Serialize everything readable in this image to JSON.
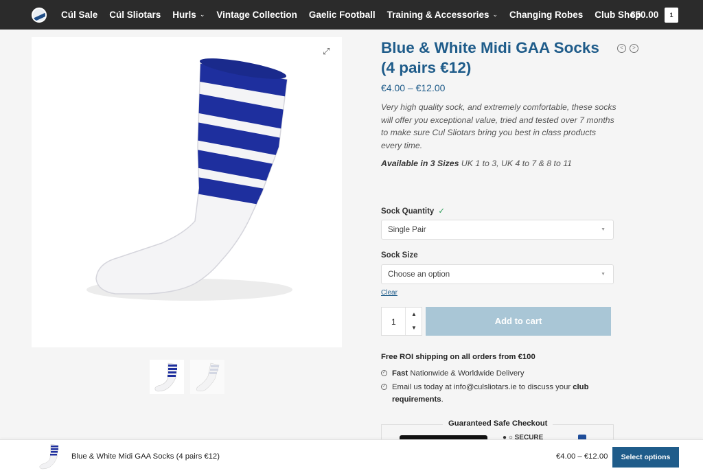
{
  "nav": {
    "items": [
      {
        "label": "Cúl Sale",
        "dropdown": false
      },
      {
        "label": "Cúl Sliotars",
        "dropdown": false
      },
      {
        "label": "Hurls",
        "dropdown": true
      },
      {
        "label": "Vintage Collection",
        "dropdown": false
      },
      {
        "label": "Gaelic Football",
        "dropdown": false
      },
      {
        "label": "Training & Accessories",
        "dropdown": true
      },
      {
        "label": "Changing Robes",
        "dropdown": false
      },
      {
        "label": "Club Shop",
        "dropdown": false
      }
    ],
    "cart_total": "€50.00",
    "cart_count": "1"
  },
  "product": {
    "title": "Blue & White Midi GAA Socks (4 pairs €12)",
    "price_range": "€4.00 – €12.00",
    "description": "Very high quality sock, and extremely comfortable, these socks will offer you exceptional value, tried and tested over 7 months to make sure Cul Sliotars bring you best in class products every time.",
    "availability_bold": "Available in 3 Sizes",
    "availability_text": " UK 1 to 3, UK 4 to 7 & 8 to 11"
  },
  "form": {
    "quantity_label": "Sock Quantity",
    "quantity_selected": "Single Pair",
    "size_label": "Sock Size",
    "size_selected": "Choose an option",
    "clear_label": "Clear",
    "qty_value": "1",
    "add_to_cart": "Add to cart"
  },
  "shipping": {
    "headline": "Free ROI  shipping on all orders from €100",
    "feature1_bold": "Fast",
    "feature1_text": " Nationwide & Worldwide Delivery",
    "feature2_pre": "Email us today at ",
    "feature2_email": "info@culsliotars.ie",
    "feature2_mid": " to discuss your ",
    "feature2_bold": "club requirements",
    "feature2_end": ".",
    "checkout_title": "Guaranteed Safe Checkout",
    "secure_label": "SECURE"
  },
  "sticky": {
    "title": "Blue & White Midi GAA Socks (4 pairs €12)",
    "price": "€4.00 – €12.00",
    "button": "Select options"
  },
  "colors": {
    "nav_bg": "#2b2b2b",
    "brand_blue": "#1f5c8a",
    "sock_navy": "#1e2f9e",
    "add_to_cart_disabled": "#a9c6d6"
  }
}
